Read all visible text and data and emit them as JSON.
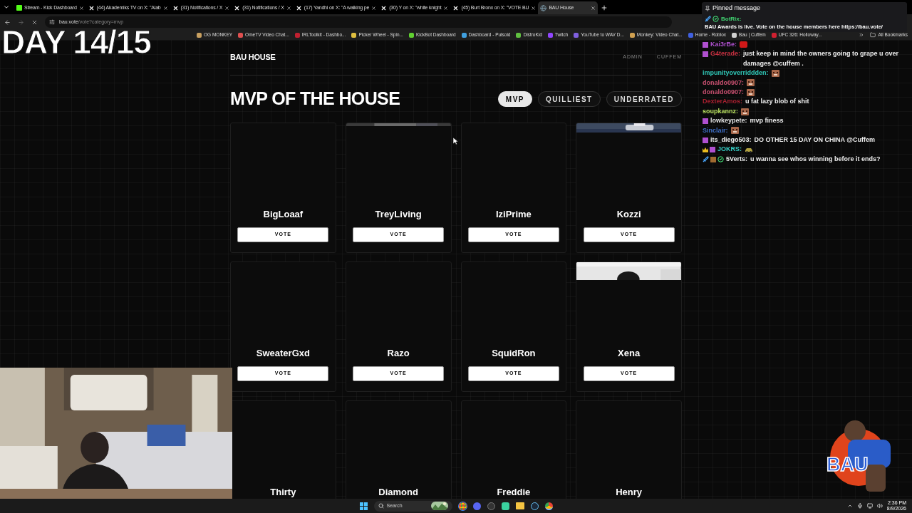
{
  "browser": {
    "tabs": [
      {
        "title": "Stream - Kick Dashboard",
        "kind": "kick",
        "selected": false
      },
      {
        "title": "(44) Akademiks TV on X: \"Alab",
        "kind": "x",
        "selected": false
      },
      {
        "title": "(31) Notifications / X",
        "kind": "x",
        "selected": false
      },
      {
        "title": "(31) Notifications / X",
        "kind": "x",
        "selected": false
      },
      {
        "title": "(17) Yandhi on X: \"A walking pe",
        "kind": "x",
        "selected": false
      },
      {
        "title": "(30) Y on X: \"white knight",
        "kind": "x",
        "selected": false
      },
      {
        "title": "(45) Burt Bronx on X: \"VOTE BU",
        "kind": "x",
        "selected": false
      },
      {
        "title": "BAU House",
        "kind": "site",
        "selected": true
      }
    ],
    "url_host": "bau.vote",
    "url_path": "/vote?category=mvp",
    "bookmarks": [
      {
        "label": "OG MONKEY",
        "color": "#c8a060"
      },
      {
        "label": "OmeTV Video Chat...",
        "color": "#e05050"
      },
      {
        "label": "IRLToolkit - Dashbo...",
        "color": "#c02030"
      },
      {
        "label": "Picker Wheel - Spin...",
        "color": "#e0c040"
      },
      {
        "label": "KickBot Dashboard",
        "color": "#60d030"
      },
      {
        "label": "Dashboard - Pulsoid",
        "color": "#40a0e0"
      },
      {
        "label": "DistroKid",
        "color": "#60c040"
      },
      {
        "label": "Twitch",
        "color": "#9146ff"
      },
      {
        "label": "YouTube to WAV D...",
        "color": "#8060e0"
      },
      {
        "label": "Monkey: Video Chat...",
        "color": "#d0a050"
      },
      {
        "label": "Home - Roblox",
        "color": "#4060e0"
      },
      {
        "label": "Bau | Cuffem",
        "color": "#d0d0d0"
      },
      {
        "label": "UFC 326: Holloway...",
        "color": "#d02030"
      }
    ],
    "all_bookmarks": "All Bookmarks"
  },
  "overlay": {
    "day_counter": "DAY 14/15",
    "logo_text": "BAU"
  },
  "page": {
    "brand": "BAU HOUSE",
    "nav": [
      "ADMIN",
      "CUFFEM"
    ],
    "title": "MVP OF THE HOUSE",
    "categories": [
      {
        "label": "MVP",
        "selected": true
      },
      {
        "label": "QUILLIEST",
        "selected": false
      },
      {
        "label": "UNDERRATED",
        "selected": false
      }
    ],
    "candidates": [
      {
        "name": "BigLoaaf",
        "kind": "blank",
        "button": "VOTE"
      },
      {
        "name": "TreyLiving",
        "kind": "sliver",
        "button": "VOTE"
      },
      {
        "name": "IziPrime",
        "kind": "blank",
        "button": "VOTE"
      },
      {
        "name": "Kozzi",
        "kind": "strip",
        "button": "VOTE"
      },
      {
        "name": "SweaterGxd",
        "kind": "blank",
        "button": "VOTE"
      },
      {
        "name": "Razo",
        "kind": "blank",
        "button": "VOTE"
      },
      {
        "name": "SquidRon",
        "kind": "blank",
        "button": "VOTE"
      },
      {
        "name": "Xena",
        "kind": "partial",
        "button": "VOTE"
      },
      {
        "name": "Thirty",
        "kind": "blank"
      },
      {
        "name": "Diamond",
        "kind": "blank"
      },
      {
        "name": "Freddie",
        "kind": "blank"
      },
      {
        "name": "Henry",
        "kind": "blank"
      }
    ]
  },
  "chat": {
    "pinned": {
      "heading": "Pinned message",
      "author": "BotRix:",
      "badges": [
        {
          "kind": "mod"
        },
        {
          "kind": "verified"
        }
      ],
      "text": "BAU Awards is live. Vote on the house members here https://bau.vote/"
    },
    "messages": [
      {
        "user": "Kai3rBe:",
        "color": "#b050d0",
        "badges": [
          {
            "kind": "sub"
          }
        ],
        "emote": {
          "kind": "red"
        }
      },
      {
        "user": "G4terade:",
        "color": "#c83040",
        "badges": [
          {
            "kind": "sub"
          }
        ],
        "text": "just keep in mind the owners going to grape u over damages @cuffem ."
      },
      {
        "user": "impunityoverriddden:",
        "color": "#30c8b8",
        "emote": {
          "kind": "face"
        }
      },
      {
        "user": "donaldo0907:",
        "color": "#c85070",
        "emote": {
          "kind": "face"
        }
      },
      {
        "user": "donaldo0907:",
        "color": "#c85070",
        "emote": {
          "kind": "face"
        }
      },
      {
        "user": "DexterAmos:",
        "color": "#a82030",
        "text": "u fat lazy blob of shit"
      },
      {
        "user": "soupkannz:",
        "color": "#b8e060",
        "emote": {
          "kind": "face"
        }
      },
      {
        "user": "lowkeypete:",
        "color": "#e0e0e0",
        "badges": [
          {
            "kind": "sub"
          }
        ],
        "text": "mvp finess"
      },
      {
        "user": "Sinclair:",
        "color": "#4070c8",
        "emote": {
          "kind": "face"
        }
      },
      {
        "user": "its_diego503:",
        "color": "#f0f0f0",
        "badges": [
          {
            "kind": "sub"
          }
        ],
        "text": "DO OTHER 15 DAY ON CHINA @Cuffem"
      },
      {
        "user": "JOKRS:",
        "color": "#38d0c8",
        "badges": [
          {
            "kind": "crown"
          },
          {
            "kind": "sub"
          }
        ],
        "emote": {
          "kind": "car"
        }
      },
      {
        "user": "5Verts:",
        "color": "#f0f0f0",
        "badges": [
          {
            "kind": "mod"
          },
          {
            "kind": "gift"
          },
          {
            "kind": "verified"
          }
        ],
        "text": "u wanna see whos winning before it ends?"
      }
    ]
  },
  "taskbar": {
    "search_placeholder": "Search",
    "time": "2:36 PM",
    "date": "8/9/2026"
  }
}
